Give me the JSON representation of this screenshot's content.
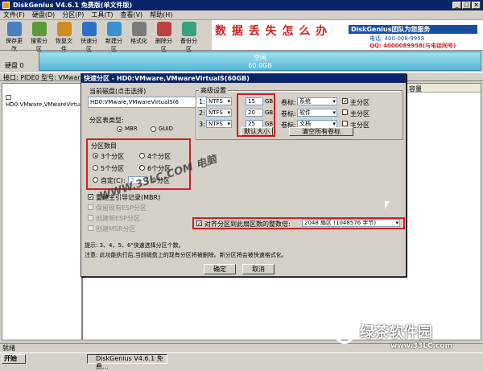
{
  "app": {
    "title": "DiskGenius V4.6.1 免费版(单文件版)"
  },
  "menu": [
    "文件(F)",
    "硬盘(D)",
    "分区(P)",
    "工具(T)",
    "查看(V)",
    "帮助(H)"
  ],
  "toolbar": [
    {
      "label": "保存更改",
      "color": "#4a7fc0"
    },
    {
      "label": "搜索分区",
      "color": "#5a9a3a"
    },
    {
      "label": "恢复文件",
      "color": "#d08a20"
    },
    {
      "label": "快速分区",
      "color": "#2a70c8"
    },
    {
      "label": "新建分区",
      "color": "#3a90d0"
    },
    {
      "label": "格式化",
      "color": "#7a7a7a"
    },
    {
      "label": "删除分区",
      "color": "#c04040"
    },
    {
      "label": "备份分区",
      "color": "#3aa080"
    }
  ],
  "banner": {
    "line1": "数 据 丢 失 怎 么 办",
    "brand": "DiskGenius团队为您服务",
    "phone": "电话: 400-008-9958",
    "qq": "QQ: 4000089958(与电话同号)"
  },
  "disk": {
    "label": "硬盘 0",
    "bar_line1": "空闲",
    "bar_line2": "60.0GB"
  },
  "infobar": {
    "text": "接口: PIDE0   型号: VMware,VMwareVirtual"
  },
  "tree": {
    "item": "HD0:VMware,VMwareVirtualS"
  },
  "right": {
    "col_capacity": "容量"
  },
  "status": {
    "text": "就绪"
  },
  "taskbar": {
    "start": "开始",
    "item": "DiskGenius V4.6.1 免费..."
  },
  "dialog": {
    "title": "快速分区 - HD0:VMware,VMwareVirtualS(60GB)",
    "current_disk_label": "当前磁盘(点击选择)",
    "current_disk_value": "HD0:VMware,VMwareVirtualS(6",
    "table_type_label": "分区表类型:",
    "mbr": "MBR",
    "guid": "GUID",
    "count_group": "分区数目",
    "count_options": [
      "3个分区",
      "4个分区",
      "5个分区",
      "6个分区"
    ],
    "custom_label": "自定(C):",
    "custom_value": "2",
    "custom_suffix": "个分区",
    "rebuild_mbr": "重建主引导记录(MBR)",
    "opt_esp": "保留现有ESP分区",
    "opt_new_esp": "创建新ESP分区",
    "opt_msr": "创建MSR分区",
    "advanced_group": "高级设置",
    "rows": [
      {
        "num": "1:",
        "fs": "NTFS",
        "size": "15",
        "unit": "GB",
        "vol_label": "卷标:",
        "vol": "系统",
        "primary": "主分区"
      },
      {
        "num": "2:",
        "fs": "NTFS",
        "size": "20",
        "unit": "GB",
        "vol_label": "卷标:",
        "vol": "软件",
        "primary": "主分区"
      },
      {
        "num": "3:",
        "fs": "NTFS",
        "size": "25",
        "unit": "GB",
        "vol_label": "卷标:",
        "vol": "文档",
        "primary": "主分区"
      }
    ],
    "default_size_btn": "默认大小",
    "clear_labels_btn": "清空所有卷标",
    "align_label": "对齐分区到此扇区数的整数倍:",
    "align_value": "2048 扇区 (1048576 字节)",
    "tip1": "提示: 3、4、5、6\"快速选择分区个数。",
    "tip2": "注意: 此功能执行后,当前磁盘上的现有分区将被删除。新分区将会被快速格式化。",
    "ok": "确定",
    "cancel": "取消"
  },
  "watermark": "WWW.33LC.COM 电脑",
  "logo": {
    "name": "绿茶软件园",
    "url": "www.33LC.com"
  }
}
